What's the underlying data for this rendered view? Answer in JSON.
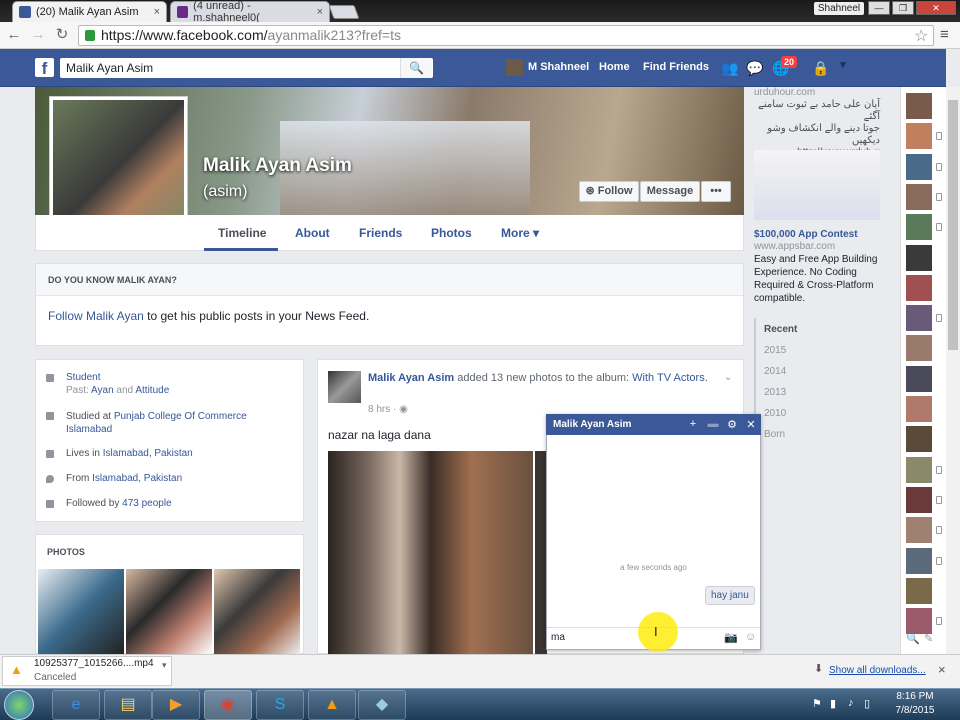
{
  "browser": {
    "tabs": [
      {
        "label": "(20) Malik Ayan Asim",
        "close": "×"
      },
      {
        "label": "(4 unread) - m.shahneel0(",
        "close": "×"
      }
    ],
    "profile_badge": "Shahneel",
    "window_buttons": [
      "—",
      "❐",
      "✕"
    ],
    "url_host": "https://www.facebook.com/",
    "url_path": "ayanmalik213?fref=ts"
  },
  "fb_nav": {
    "search_value": "Malik Ayan Asim",
    "user_name": "M Shahneel",
    "home": "Home",
    "find_friends": "Find Friends",
    "notif_count": "20"
  },
  "profile": {
    "name": "Malik Ayan Asim",
    "alt_name": "(asim)",
    "buttons": {
      "follow": "Follow",
      "message": "Message",
      "more": "•••"
    },
    "tabs": [
      "Timeline",
      "About",
      "Friends",
      "Photos",
      "More ▾"
    ]
  },
  "know_box": {
    "heading": "DO YOU KNOW MALIK AYAN?",
    "link": "Follow Malik Ayan",
    "text": " to get his public posts in your News Feed."
  },
  "intro": {
    "student": "Student",
    "past_prefix": "Past: ",
    "past_1": "Ayan",
    "past_and": " and ",
    "past_2": "Attitude",
    "studied_prefix": "Studied at ",
    "studied_school": "Punjab College Of Commerce Islamabad",
    "lives_prefix": "Lives in ",
    "lives_city": "Islamabad, Pakistan",
    "from_prefix": "From ",
    "from_city": "Islamabad, Pakistan",
    "followed_prefix": "Followed by ",
    "followed_count": "473 people"
  },
  "photos": {
    "heading": "PHOTOS"
  },
  "post": {
    "author": "Malik Ayan Asim",
    "action": " added 13 new photos to the album: ",
    "album": "With TV Actors.",
    "time": "8 hrs · ",
    "text": "nazar na laga dana"
  },
  "chat": {
    "title": "Malik Ayan Asim",
    "timestamp": "a few seconds ago",
    "message": "hay janu",
    "input_value": "ma"
  },
  "right": {
    "urdu_line1": "آیان علی حامد بے ثبوت سامنے آگئے",
    "urdu_line2": "جوتا دینے والے انکشاف وشو دیکھیں",
    "urdu_url": "http://www.urduh ::",
    "urdu_top": "urduhour.com",
    "ad_title": "$100,000 App Contest",
    "ad_url": "www.appsbar.com",
    "ad_text": "Easy and Free App Building Experience. No Coding Required & Cross-Platform compatible.",
    "years": [
      "Recent",
      "2015",
      "2014",
      "2013",
      "2010",
      "Born"
    ]
  },
  "downloads": {
    "file": "10925377_1015266....mp4",
    "status": "Canceled",
    "show_all": "Show all downloads...",
    "close": "×"
  },
  "taskbar": {
    "time": "8:16 PM",
    "date": "7/8/2015"
  }
}
